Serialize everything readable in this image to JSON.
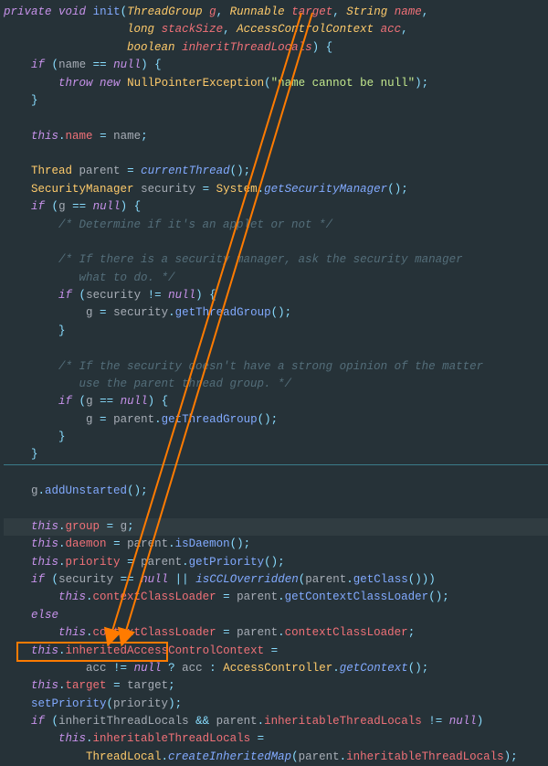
{
  "code": {
    "l1a": "private",
    "l1b": "void",
    "l1c": "init",
    "l1d": "ThreadGroup",
    "l1e": "g",
    "l1f": "Runnable",
    "l1g": "target",
    "l1h": "String",
    "l1i": "name",
    "l2a": "long",
    "l2b": "stackSize",
    "l2c": "AccessControlContext",
    "l2d": "acc",
    "l3a": "boolean",
    "l3b": "inheritThreadLocals",
    "l4a": "if",
    "l4b": "name",
    "l4c": "null",
    "l5a": "throw",
    "l5b": "new",
    "l5c": "NullPointerException",
    "l5d": "\"name cannot be null\"",
    "l8a": "this",
    "l8b": "name",
    "l8c": "name",
    "l10a": "Thread",
    "l10b": "parent",
    "l10c": "currentThread",
    "l11a": "SecurityManager",
    "l11b": "security",
    "l11c": "System",
    "l11d": "getSecurityManager",
    "l12a": "if",
    "l12b": "g",
    "l12c": "null",
    "l13": "/* Determine if it's an applet or not */",
    "l15": "/* If there is a security manager, ask the security manager",
    "l16": "   what to do. */",
    "l17a": "if",
    "l17b": "security",
    "l17c": "null",
    "l18a": "g",
    "l18b": "security",
    "l18c": "getThreadGroup",
    "l21": "/* If the security doesn't have a strong opinion of the matter",
    "l22": "   use the parent thread group. */",
    "l23a": "if",
    "l23b": "g",
    "l23c": "null",
    "l24a": "g",
    "l24b": "parent",
    "l24c": "getThreadGroup",
    "l28a": "g",
    "l28b": "addUnstarted",
    "l30a": "this",
    "l30b": "group",
    "l30c": "g",
    "l31a": "this",
    "l31b": "daemon",
    "l31c": "parent",
    "l31d": "isDaemon",
    "l32a": "this",
    "l32b": "priority",
    "l32c": "parent",
    "l32d": "getPriority",
    "l33a": "if",
    "l33b": "security",
    "l33c": "null",
    "l33d": "isCCLOverridden",
    "l33e": "parent",
    "l33f": "getClass",
    "l34a": "this",
    "l34b": "contextClassLoader",
    "l34c": "parent",
    "l34d": "getContextClassLoader",
    "l35a": "else",
    "l36a": "this",
    "l36b": "contextClassLoader",
    "l36c": "parent",
    "l36d": "contextClassLoader",
    "l37a": "this",
    "l37b": "inheritedAccessControlContext",
    "l38a": "acc",
    "l38b": "null",
    "l38c": "acc",
    "l38d": "AccessController",
    "l38e": "getContext",
    "l39a": "this",
    "l39b": "target",
    "l39c": "target",
    "l40a": "setPriority",
    "l40b": "priority",
    "l41a": "if",
    "l41b": "inheritThreadLocals",
    "l41c": "parent",
    "l41d": "inheritableThreadLocals",
    "l41e": "null",
    "l42a": "this",
    "l42b": "inheritableThreadLocals",
    "l43a": "ThreadLocal",
    "l43b": "createInheritedMap",
    "l43c": "parent",
    "l43d": "inheritableThreadLocals"
  },
  "annotations": {
    "arrow_from": "Runnable target parameter",
    "arrow_to": "this.target = target; assignment",
    "highlight": "this.target = target;"
  }
}
